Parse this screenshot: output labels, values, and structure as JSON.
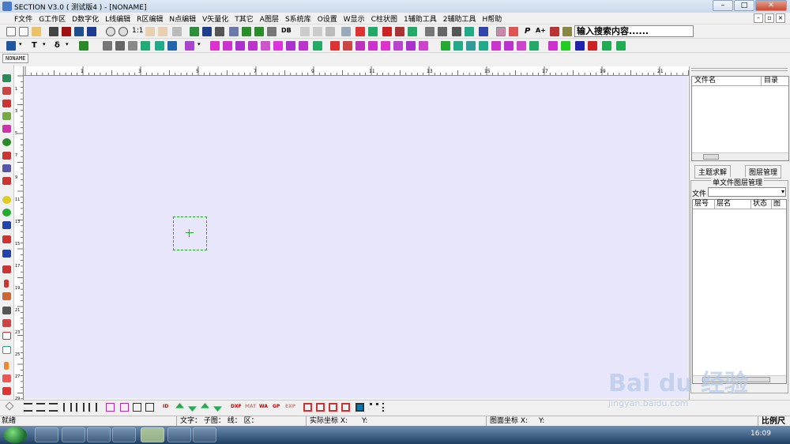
{
  "window": {
    "title": "SECTION V3.0 ( 测试版4 ) - [NONAME]",
    "minimize": "–",
    "maximize": "□",
    "close": "✕"
  },
  "menu": [
    "F文件",
    "G工作区",
    "D数字化",
    "L线编辑",
    "R区编辑",
    "N点编辑",
    "V矢量化",
    "T其它",
    "A图层",
    "S系统库",
    "O设置",
    "W显示",
    "C柱状图",
    "1辅助工具",
    "2辅助工具",
    "H帮助"
  ],
  "toolbar": {
    "zoom_label": "1:1",
    "db_label": "DB",
    "p_label": "P",
    "a_label": "A+",
    "search_value": "输入搜索内容......",
    "t_label": "T",
    "delta_label": "δ"
  },
  "document_tab": "NONAME",
  "ruler": {
    "h_ticks": [
      "1",
      "3",
      "5",
      "7",
      "9",
      "11",
      "13",
      "15",
      "17",
      "19",
      "21",
      "23",
      "25",
      "27"
    ],
    "v_ticks": [
      "1",
      "3",
      "5",
      "7",
      "9",
      "11",
      "13",
      "15",
      "17",
      "19",
      "21",
      "23",
      "25",
      "27",
      "29"
    ]
  },
  "right_panel": {
    "file_list": {
      "col_name": "文件名",
      "col_dir": "目录"
    },
    "tab_solve": "主题求解",
    "tab_layer_mgmt": "图层管理",
    "group_title": "单文件图层管理",
    "file_label": "文件",
    "layer_cols": [
      "层号",
      "层名",
      "状态",
      "图元"
    ]
  },
  "bottom_toolbar": {
    "id_label": "ID",
    "dxf_label": "DXF",
    "mat_label": "MAT",
    "wa_label": "WA",
    "gp_label": "GP",
    "exp_label": "EXP"
  },
  "status": {
    "ready": "就绪",
    "text_info": "文字： 子图： 线： 区：",
    "real_coord_label": "实际坐标 X:",
    "real_coord_y": "Y:",
    "map_coord_label": "图面坐标 X:",
    "map_coord_y": "Y:",
    "scale_label": "比例尺"
  },
  "taskbar": {
    "time": "16:09"
  },
  "watermark": {
    "brand": "Bai du 经验",
    "url": "jingyan.baidu.com"
  },
  "colors": {
    "canvas_bg": "#e8e6fb",
    "selection": "#1fb41f"
  }
}
